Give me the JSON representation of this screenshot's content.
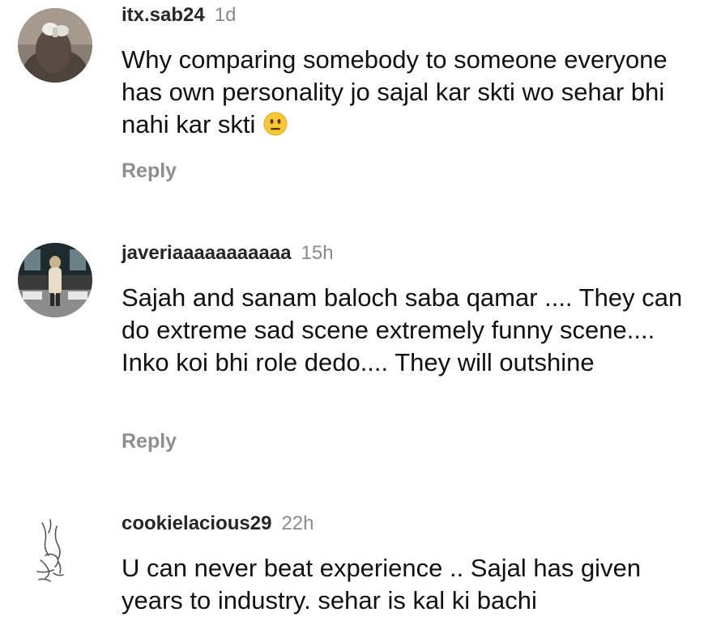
{
  "comments": [
    {
      "username": "itx.sab24",
      "time": "1d",
      "text": "Why comparing somebody to someone everyone has own personality jo sajal kar skti wo sehar bhi nahi kar skti",
      "emoji": "neutral-face",
      "reply_label": "Reply"
    },
    {
      "username": "javeriaaaaaaaaaaa",
      "time": "15h",
      "text": "Sajah and sanam baloch saba qamar .... They can do extreme sad scene extremely funny scene.... Inko koi bhi role dedo.... They will outshine",
      "reply_label": "Reply"
    },
    {
      "username": "cookielacious29",
      "time": "22h",
      "text": "U can never beat experience .. Sajal has given years to industry. sehar is kal ki bachi"
    }
  ]
}
